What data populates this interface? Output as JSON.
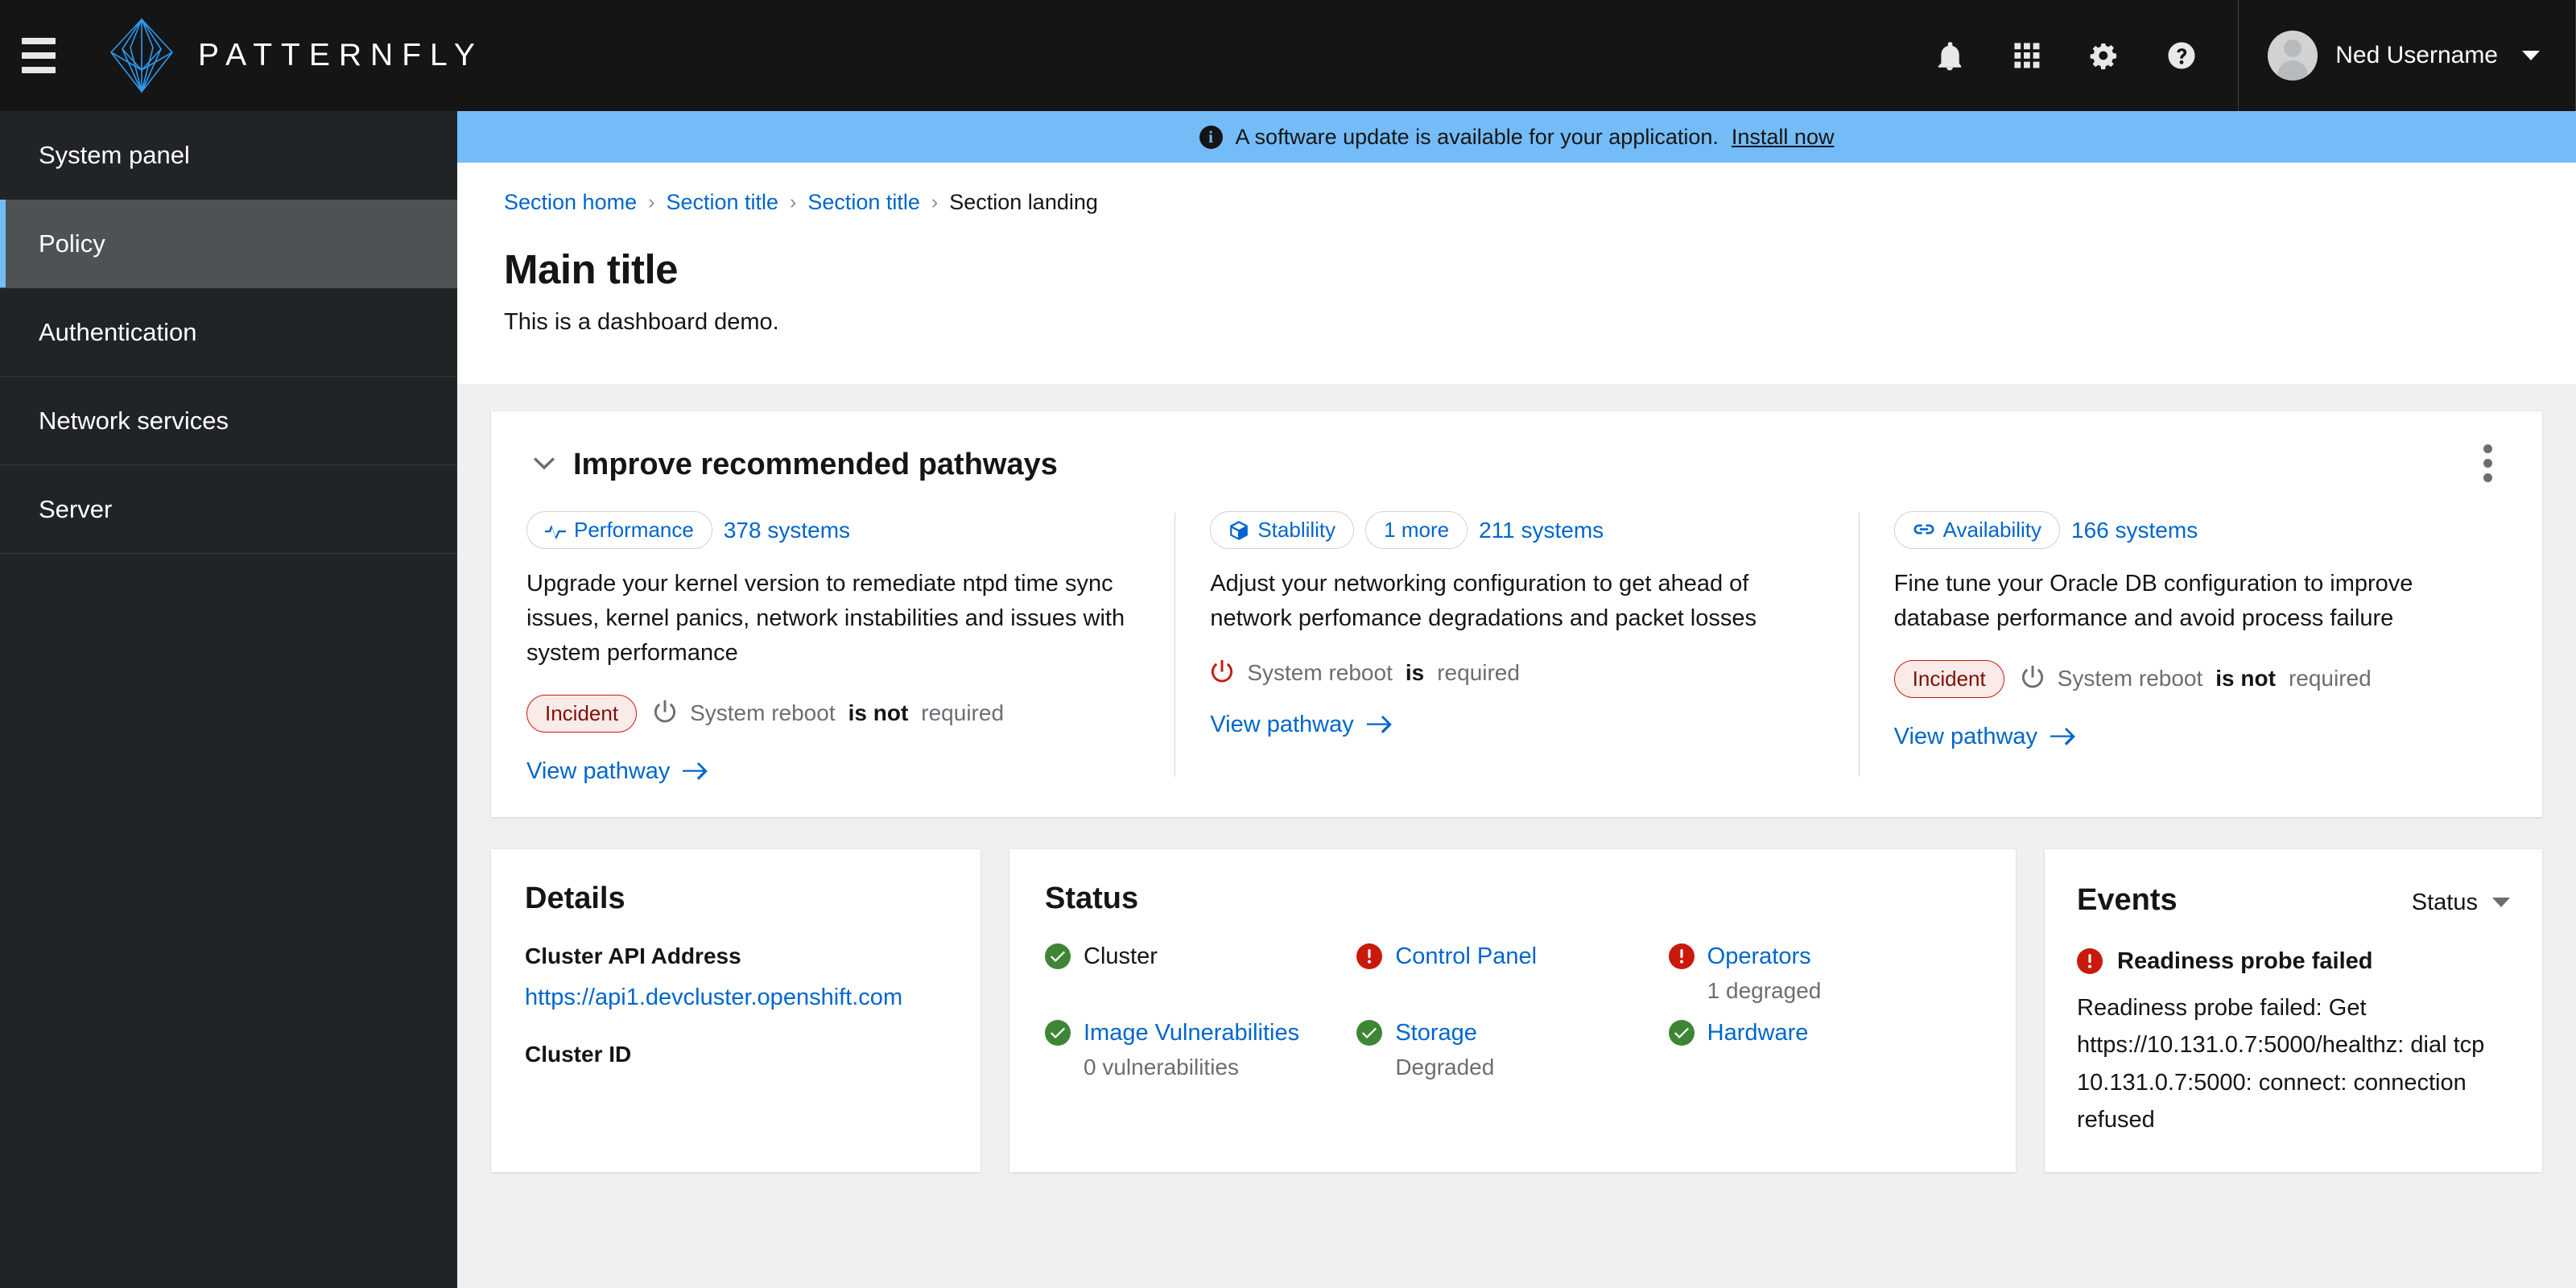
{
  "masthead": {
    "menu_icon": "hamburger-icon",
    "brand_name": "PATTERNFLY",
    "icons": [
      "bell-icon",
      "grid-apps-icon",
      "gear-icon",
      "help-icon"
    ],
    "user_name": "Ned Username"
  },
  "sidebar": {
    "items": [
      {
        "label": "System panel",
        "active": false
      },
      {
        "label": "Policy",
        "active": true
      },
      {
        "label": "Authentication",
        "active": false
      },
      {
        "label": "Network services",
        "active": false
      },
      {
        "label": "Server",
        "active": false
      }
    ]
  },
  "banner": {
    "icon": "info-circle-icon",
    "text": "A software update is available for your application.",
    "link": "Install now"
  },
  "breadcrumb": {
    "items": [
      {
        "label": "Section home",
        "link": true
      },
      {
        "label": "Section title",
        "link": true
      },
      {
        "label": "Section title",
        "link": true
      },
      {
        "label": "Section landing",
        "link": false
      }
    ],
    "separator": "›"
  },
  "page": {
    "title": "Main title",
    "subtitle": "This is a dashboard demo."
  },
  "pathways": {
    "title": "Improve recommended pathways",
    "toggle_icon": "chevron-down-icon",
    "kebab_icon": "kebab-menu-icon",
    "link_label": "View pathway",
    "link_icon": "arrow-right-icon",
    "columns": [
      {
        "category": "Performance",
        "category_icon": "pulse-icon",
        "extra_pill": "",
        "systems": "378 systems",
        "description": "Upgrade your kernel version to remediate ntpd time sync issues, kernel panics, network instabilities and issues with system performance",
        "incident": "Incident",
        "has_incident": true,
        "reboot_prefix": "System reboot ",
        "reboot_emphasis": "is not",
        "reboot_suffix": " required",
        "reboot_required": false
      },
      {
        "category": "Stablility",
        "category_icon": "cube-icon",
        "extra_pill": "1 more",
        "systems": "211 systems",
        "description": "Adjust your networking configuration to get ahead of network perfomance degradations and packet losses",
        "incident": "",
        "has_incident": false,
        "reboot_prefix": "System reboot ",
        "reboot_emphasis": "is",
        "reboot_suffix": " required",
        "reboot_required": true
      },
      {
        "category": "Availability",
        "category_icon": "link-chain-icon",
        "extra_pill": "",
        "systems": "166 systems",
        "description": "Fine tune your Oracle DB configuration to improve database performance and avoid process failure",
        "incident": "Incident",
        "has_incident": true,
        "reboot_prefix": "System reboot ",
        "reboot_emphasis": "is not",
        "reboot_suffix": " required",
        "reboot_required": false
      }
    ]
  },
  "details": {
    "title": "Details",
    "api_label": "Cluster API Address",
    "api_value": "https://api1.devcluster.openshift.com",
    "cluster_id_label": "Cluster ID"
  },
  "status": {
    "title": "Status",
    "items": [
      {
        "name": "Cluster",
        "state": "ok",
        "sub": "",
        "link": false
      },
      {
        "name": "Control Panel",
        "state": "err",
        "sub": "",
        "link": true
      },
      {
        "name": "Operators",
        "state": "err",
        "sub": "1 degraged",
        "link": true
      },
      {
        "name": "Image Vulnerabilities",
        "state": "ok",
        "sub": "0 vulnerabilities",
        "link": true
      },
      {
        "name": "Storage",
        "state": "ok",
        "sub": "Degraded",
        "link": true
      },
      {
        "name": "Hardware",
        "state": "ok",
        "sub": "",
        "link": true
      }
    ]
  },
  "events": {
    "title": "Events",
    "filter_label": "Status",
    "filter_icon": "chevron-down-icon",
    "items": [
      {
        "title": "Readiness probe failed",
        "state": "err",
        "body": "Readiness probe failed: Get https://10.131.0.7:5000/healthz: dial tcp 10.131.0.7:5000: connect: connection refused"
      }
    ]
  },
  "colors": {
    "brand_dark": "#151515",
    "sidebar": "#212427",
    "accent_blue": "#06c",
    "banner_blue": "#73bcf7",
    "danger": "#c9190b",
    "success": "#3e8635"
  }
}
